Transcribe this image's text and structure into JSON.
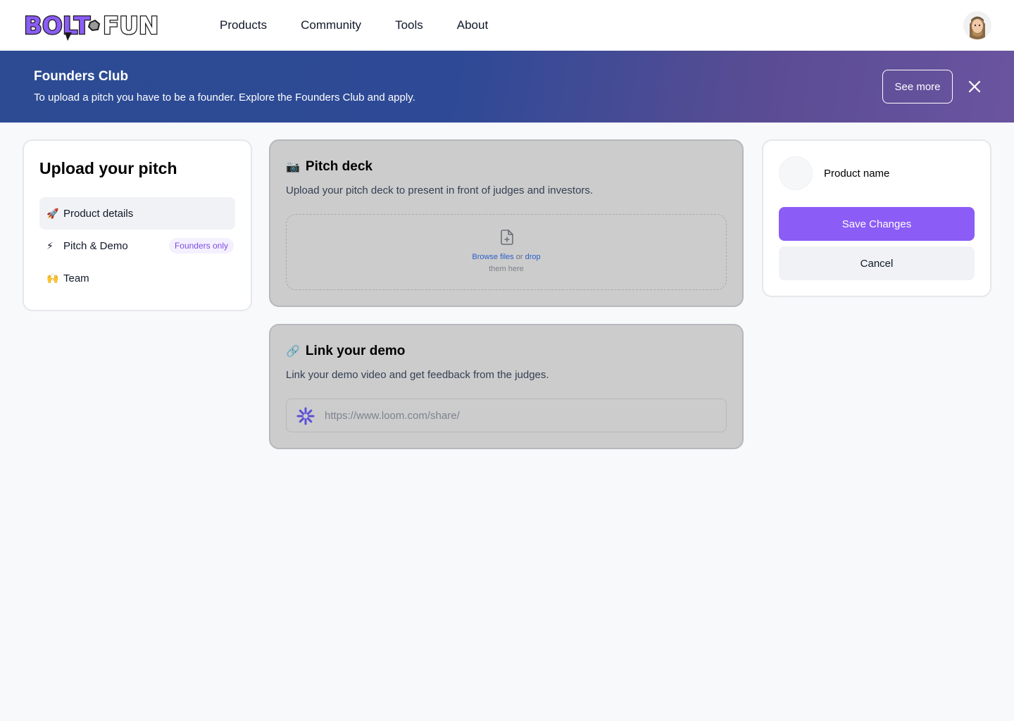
{
  "nav": {
    "logo_text": "BOLT.FUN",
    "links": [
      "Products",
      "Community",
      "Tools",
      "About"
    ]
  },
  "banner": {
    "title": "Founders Club",
    "text": "To upload a pitch you have to be a founder. Explore the Founders Club and apply.",
    "see_more_label": "See more"
  },
  "sidebar": {
    "title": "Upload your pitch",
    "items": [
      {
        "emoji": "🚀",
        "label": "Product details"
      },
      {
        "emoji": "⚡",
        "label": "Pitch & Demo",
        "badge": "Founders only"
      },
      {
        "emoji": "🙌",
        "label": "Team"
      }
    ]
  },
  "pitch_deck": {
    "emoji": "📷",
    "title": "Pitch deck",
    "description": "Upload your pitch deck to present in front of judges and investors.",
    "browse_label": "Browse files",
    "or_label": "or",
    "drop_label": "drop",
    "them_here_label": "them here"
  },
  "demo": {
    "emoji": "🔗",
    "title": "Link your demo",
    "description": "Link your demo video and get feedback from the judges.",
    "placeholder": "https://www.loom.com/share/",
    "value": ""
  },
  "product_panel": {
    "product_name": "Product name",
    "save_label": "Save Changes",
    "cancel_label": "Cancel"
  },
  "colors": {
    "accent": "#8b5cf6",
    "badge_text": "#7e4ce0",
    "link": "#2d5fc7",
    "banner_start": "#2c4b93",
    "banner_end": "#6a54a0",
    "loom": "#5b4fd8"
  }
}
